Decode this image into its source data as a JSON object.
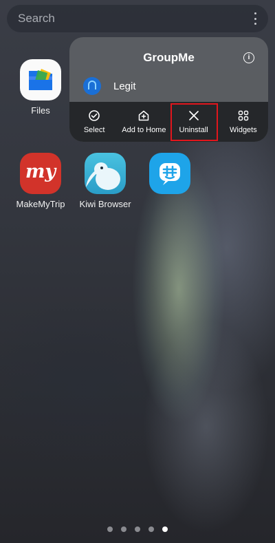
{
  "search": {
    "placeholder": "Search",
    "menu_icon": "more-vert-icon"
  },
  "apps": [
    {
      "label": "Files",
      "icon": "files-app-icon"
    },
    {
      "label": "MakeMyTrip",
      "icon": "makemytrip-app-icon",
      "icon_text": "my"
    },
    {
      "label": "Kiwi Browser",
      "icon": "kiwi-browser-app-icon"
    },
    {
      "label": "",
      "icon": "groupme-app-icon"
    }
  ],
  "popup": {
    "title": "GroupMe",
    "info_icon": "info-icon",
    "shortcut": {
      "label": "Legit",
      "icon": "legit-shortcut-icon"
    },
    "actions": [
      {
        "label": "Select",
        "icon": "select-check-icon"
      },
      {
        "label": "Add to Home",
        "icon": "add-to-home-icon"
      },
      {
        "label": "Uninstall",
        "icon": "close-icon",
        "highlighted": true
      },
      {
        "label": "Widgets",
        "icon": "widgets-grid-icon"
      }
    ]
  },
  "pager": {
    "count": 5,
    "active": 5
  },
  "colors": {
    "highlight": "#e3161d",
    "makemytrip": "#d2332a",
    "groupme": "#1ea4e9"
  }
}
